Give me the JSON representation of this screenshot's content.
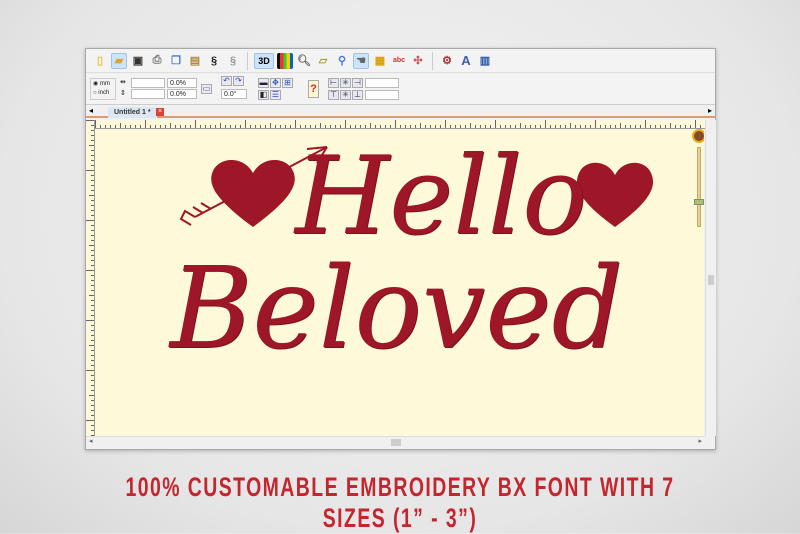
{
  "toolbar": {
    "icons": [
      "new-icon",
      "open-icon",
      "save-icon",
      "print-icon",
      "copy-icon",
      "paste-icon",
      "stitch-icon",
      "stitch2-icon",
      "3d-button",
      "color-icon",
      "zoom-icon",
      "ruler-icon",
      "hoop-icon",
      "hand-icon",
      "card-icon",
      "abc-icon",
      "pattern-icon",
      "settings-icon",
      "text-icon",
      "export-icon"
    ],
    "three_d_label": "3D",
    "text_tool_label": "A"
  },
  "properties": {
    "unit_mm": "mm",
    "unit_inch": "inch",
    "width_pct": "0.0%",
    "height_pct": "0.0%",
    "rotation": "0.0°",
    "help_label": "?"
  },
  "tabs": [
    {
      "label": "Untitled 1 *"
    }
  ],
  "design": {
    "line1": "Hello",
    "line2": "Beloved",
    "thread_color": "#9d1729"
  },
  "caption": "100% CUSTOMABLE EMBROIDERY BX FONT WITH 7 SIZES (1” -  3”)",
  "colors": {
    "caption": "#c4262e",
    "canvas": "#fefad9"
  }
}
